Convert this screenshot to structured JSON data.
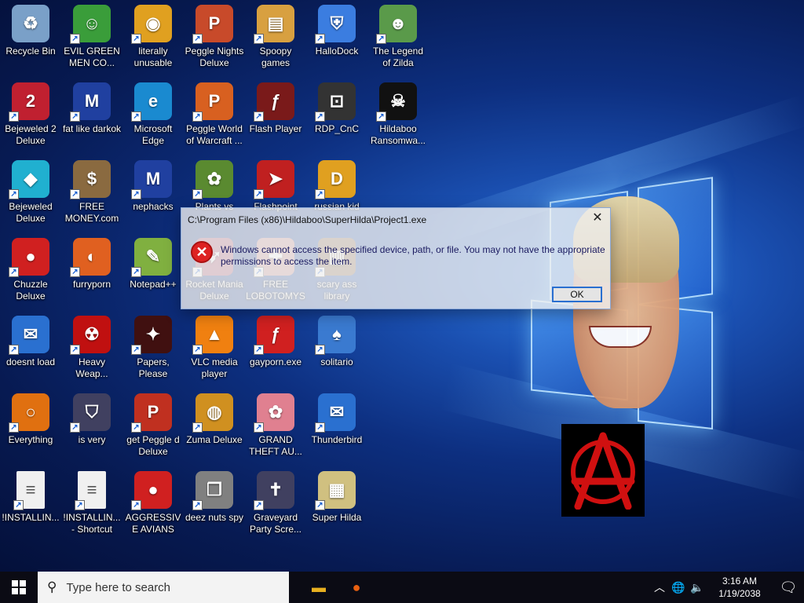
{
  "desktop": {
    "icons": [
      {
        "label": "Recycle Bin",
        "icon": "recycle-bin-icon",
        "color": "#7aa0c8"
      },
      {
        "label": "EVIL GREEN MEN CO...",
        "icon": "green-people-icon",
        "color": "#3a9d3a"
      },
      {
        "label": "literally unusable",
        "icon": "chrome-icon",
        "color": "#e0a020"
      },
      {
        "label": "Peggle Nights Deluxe",
        "icon": "peggle-icon",
        "color": "#c84a2a"
      },
      {
        "label": "Spoopy games",
        "icon": "folder-icon",
        "color": "#d8a040"
      },
      {
        "label": "HalloDock",
        "icon": "windows-shield-icon",
        "color": "#3b7de0"
      },
      {
        "label": "The Legend of Zilda",
        "icon": "zelda-character-icon",
        "color": "#5a9a4a"
      },
      {
        "label": "Bejeweled 2 Deluxe",
        "icon": "bejeweled-2-icon",
        "color": "#c02030"
      },
      {
        "label": "fat like darkok",
        "icon": "mpi-logo-icon",
        "color": "#2040a0"
      },
      {
        "label": "Microsoft Edge",
        "icon": "edge-icon",
        "color": "#1a8ad0"
      },
      {
        "label": "Peggle World of Warcraft ...",
        "icon": "peggle-icon",
        "color": "#d86020"
      },
      {
        "label": "Flash Player",
        "icon": "flash-icon",
        "color": "#7a1a1a"
      },
      {
        "label": "RDP_CnC",
        "icon": "rdp-icon",
        "color": "#333333"
      },
      {
        "label": "Hildaboo Ransomwa...",
        "icon": "ransomware-icon",
        "color": "#111111"
      },
      {
        "label": "Bejeweled Deluxe",
        "icon": "gem-icon",
        "color": "#20b0d0"
      },
      {
        "label": "FREE MONEY.com",
        "icon": "money-bag-icon",
        "color": "#8a6a40"
      },
      {
        "label": "nephacks",
        "icon": "mpi-logo-icon",
        "color": "#2040a0"
      },
      {
        "label": "Plants vs",
        "icon": "plants-icon",
        "color": "#5a8a30"
      },
      {
        "label": "Flashpoint",
        "icon": "flashpoint-icon",
        "color": "#c02020"
      },
      {
        "label": "russian kid",
        "icon": "de-logo-icon",
        "color": "#e0a020"
      },
      {
        "label": "Chuzzle Deluxe",
        "icon": "chuzzle-icon",
        "color": "#d02020"
      },
      {
        "label": "furryporn",
        "icon": "firefox-icon",
        "color": "#e06020"
      },
      {
        "label": "Notepad++",
        "icon": "notepad-icon",
        "color": "#80b040"
      },
      {
        "label": "Rocket Mania Deluxe",
        "icon": "rocket-icon",
        "color": "#a04060"
      },
      {
        "label": "FREE LOBOTOMYS",
        "icon": "lobotomy-icon",
        "color": "#c08080"
      },
      {
        "label": "scary ass library",
        "icon": "library-icon",
        "color": "#806040"
      },
      {
        "label": "doesnt load",
        "icon": "thunderbird-icon",
        "color": "#2a70d0"
      },
      {
        "label": "Heavy Weap...",
        "icon": "radiation-icon",
        "color": "#c01010"
      },
      {
        "label": "Papers, Please",
        "icon": "papers-please-icon",
        "color": "#401010"
      },
      {
        "label": "VLC media player",
        "icon": "vlc-cone-icon",
        "color": "#f08010"
      },
      {
        "label": "gayporn.exe",
        "icon": "flash-icon",
        "color": "#d02020"
      },
      {
        "label": "solitario",
        "icon": "solitaire-icon",
        "color": "#3a7ad0"
      },
      {
        "label": "Everything",
        "icon": "magnifier-icon",
        "color": "#e07010"
      },
      {
        "label": "is very",
        "icon": "mpi-shield-icon",
        "color": "#404060"
      },
      {
        "label": "get Peggle d Deluxe",
        "icon": "peggle-icon",
        "color": "#c03020"
      },
      {
        "label": "Zuma Deluxe",
        "icon": "zuma-icon",
        "color": "#d09020"
      },
      {
        "label": "GRAND THEFT AU...",
        "icon": "anime-girl-icon",
        "color": "#e08090"
      },
      {
        "label": "Thunderbird",
        "icon": "thunderbird-icon",
        "color": "#2a70d0"
      },
      {
        "label": "!INSTALLIN...",
        "icon": "document-icon",
        "color": "#f0f0f0"
      },
      {
        "label": "!INSTALLIN... - Shortcut",
        "icon": "document-icon",
        "color": "#f0f0f0"
      },
      {
        "label": "AGGRESSIVE AVIANS",
        "icon": "angry-bird-icon",
        "color": "#d02020"
      },
      {
        "label": "deez nuts spy",
        "icon": "stacked-windows-icon",
        "color": "#808080"
      },
      {
        "label": "Graveyard Party Scre...",
        "icon": "graveyard-icon",
        "color": "#404060"
      },
      {
        "label": "Super Hilda",
        "icon": "pixel-character-icon",
        "color": "#d0c080"
      }
    ]
  },
  "dialog": {
    "title": "C:\\Program Files (x86)\\Hildaboo\\SuperHilda\\Project1.exe",
    "message": "Windows cannot access the specified device, path, or file. You may not have the appropriate permissions to access the item.",
    "ok_label": "OK",
    "close_glyph": "✕",
    "error_glyph": "✕"
  },
  "taskbar": {
    "search_placeholder": "Type here to search",
    "time": "3:16 AM",
    "date": "1/19/2038",
    "apps": [
      {
        "name": "file-explorer-icon",
        "glyph": "▬",
        "color": "#e8b020"
      },
      {
        "name": "firefox-icon",
        "glyph": "●",
        "color": "#e86010"
      }
    ]
  }
}
